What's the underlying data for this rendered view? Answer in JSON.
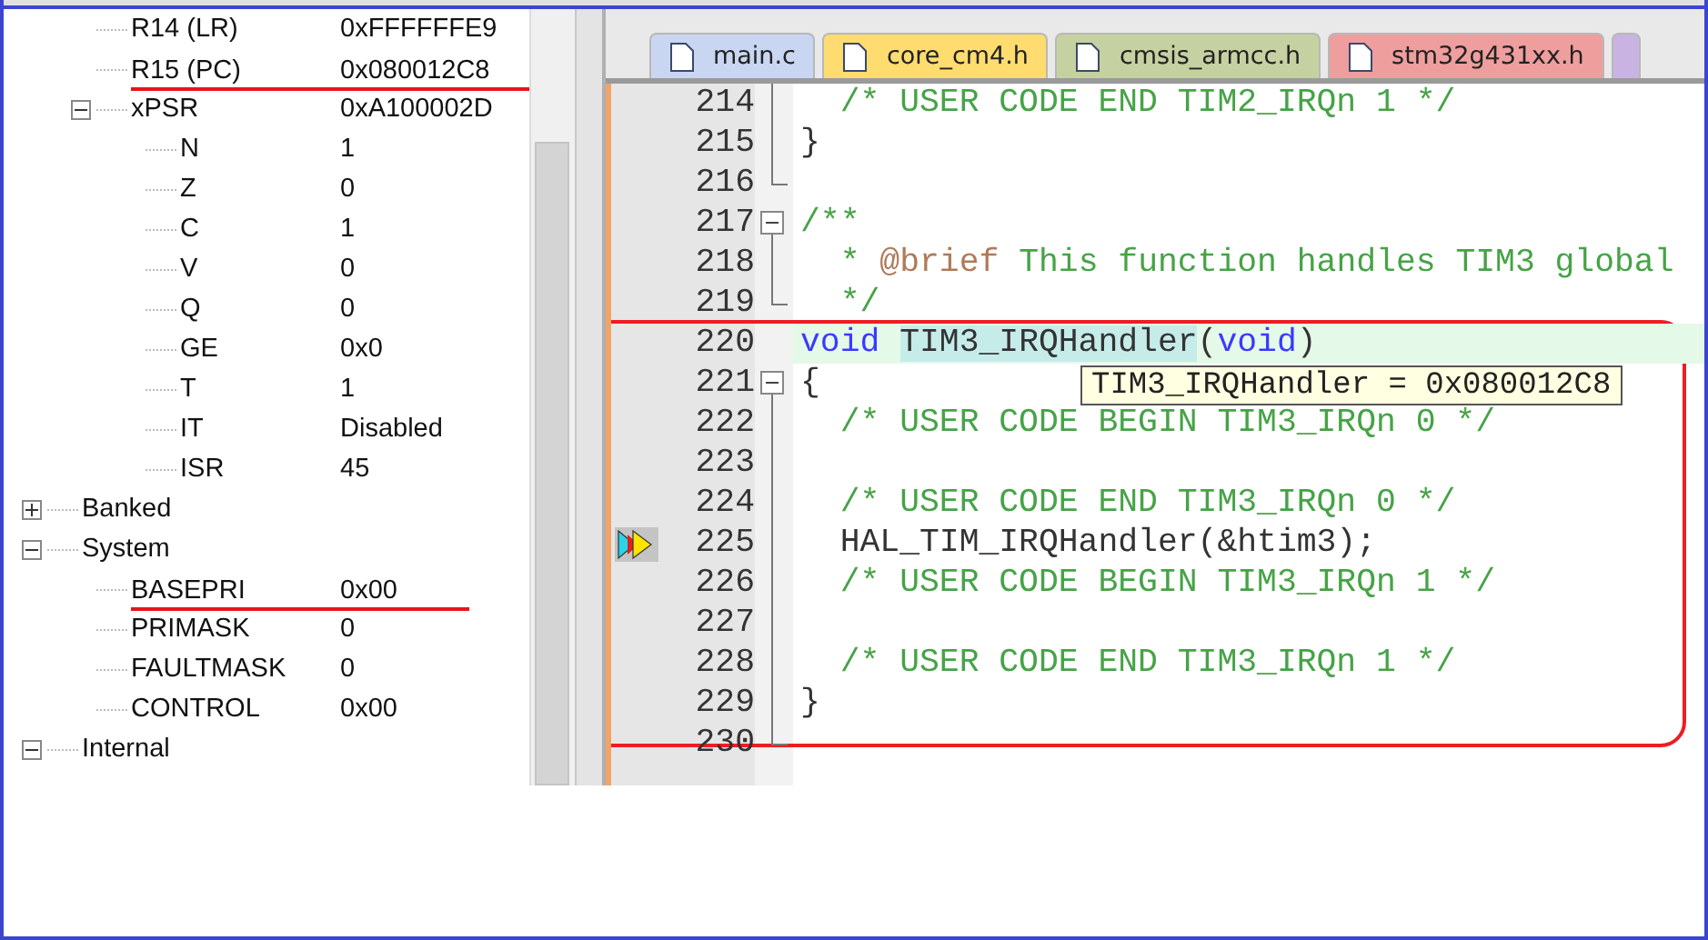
{
  "register_tree": [
    {
      "children": [
        {
          "name": "R14 (LR)",
          "value": "0xFFFFFFE9",
          "underlined": false
        },
        {
          "name": "R15 (PC)",
          "value": "0x080012C8",
          "underlined": true
        },
        {
          "name": "xPSR",
          "value": "0xA100002D",
          "underlined": false,
          "expanded": true,
          "children": [
            {
              "name": "N",
              "value": "1",
              "underlined": false
            },
            {
              "name": "Z",
              "value": "0",
              "underlined": false
            },
            {
              "name": "C",
              "value": "1",
              "underlined": false
            },
            {
              "name": "V",
              "value": "0",
              "underlined": false
            },
            {
              "name": "Q",
              "value": "0",
              "underlined": false
            },
            {
              "name": "GE",
              "value": "0x0",
              "underlined": false
            },
            {
              "name": "T",
              "value": "1",
              "underlined": false
            },
            {
              "name": "IT",
              "value": "Disabled",
              "underlined": false
            },
            {
              "name": "ISR",
              "value": "45",
              "underlined": false
            }
          ]
        }
      ]
    },
    {
      "name": "Banked",
      "expanded": false,
      "underlined": false
    },
    {
      "name": "System",
      "expanded": true,
      "underlined": false,
      "children": [
        {
          "name": "BASEPRI",
          "value": "0x00",
          "underlined": true
        },
        {
          "name": "PRIMASK",
          "value": "0",
          "underlined": false
        },
        {
          "name": "FAULTMASK",
          "value": "0",
          "underlined": false
        },
        {
          "name": "CONTROL",
          "value": "0x00",
          "underlined": false
        }
      ]
    },
    {
      "name": "Internal",
      "expanded": true,
      "underlined": false
    }
  ],
  "editor_tabs": [
    {
      "label": "main.c",
      "color": "#c9d6f2"
    },
    {
      "label": "core_cm4.h",
      "color": "#ffdc70"
    },
    {
      "label": "cmsis_armcc.h",
      "color": "#c6d1a2"
    },
    {
      "label": "stm32g431xx.h",
      "color": "#ef9e9e"
    },
    {
      "color": "#c9b3e3"
    }
  ],
  "code_lines": [
    {
      "number": "214",
      "kind": "line",
      "segments": [
        {
          "kind": "comment",
          "text": "  /* USER CODE END TIM2_IRQn 1 */"
        }
      ]
    },
    {
      "number": "215",
      "kind": "line",
      "segments": [
        {
          "kind": "plain",
          "text": "}"
        }
      ]
    },
    {
      "number": "216",
      "kind": "end"
    },
    {
      "number": "217",
      "kind": "start",
      "segments": [
        {
          "kind": "comment",
          "text": "/**"
        }
      ]
    },
    {
      "number": "218",
      "kind": "line",
      "segments": [
        {
          "kind": "comment",
          "text": "  * "
        },
        {
          "kind": "doctag",
          "text": "@brief"
        },
        {
          "kind": "comment",
          "text": " This function handles TIM3 global"
        }
      ]
    },
    {
      "number": "219",
      "kind": "end",
      "segments": [
        {
          "kind": "comment",
          "text": "  */"
        }
      ]
    }
  ],
  "annotated_code_lines": [
    {
      "number": "220",
      "kind": "none",
      "highlighted": true,
      "segments": [
        {
          "kind": "keyword",
          "text": "void "
        },
        {
          "kind": "match",
          "text": "TIM3_IRQHandler"
        },
        {
          "kind": "plain",
          "text": "("
        },
        {
          "kind": "keyword",
          "text": "void"
        },
        {
          "kind": "plain",
          "text": ")"
        }
      ]
    },
    {
      "number": "221",
      "kind": "start",
      "tooltip": "TIM3_IRQHandler = 0x080012C8",
      "segments": [
        {
          "kind": "plain",
          "text": "{"
        }
      ]
    },
    {
      "number": "222",
      "kind": "line",
      "segments": [
        {
          "kind": "comment",
          "text": "  /* USER CODE BEGIN TIM3_IRQn 0 */"
        }
      ]
    },
    {
      "number": "223",
      "kind": "line"
    },
    {
      "number": "224",
      "kind": "line",
      "segments": [
        {
          "kind": "comment",
          "text": "  /* USER CODE END TIM3_IRQn 0 */"
        }
      ]
    },
    {
      "number": "225",
      "kind": "line",
      "execution_marker": true,
      "segments": [
        {
          "kind": "plain",
          "text": "  HAL_TIM_IRQHandler(&htim3);"
        }
      ]
    },
    {
      "number": "226",
      "kind": "line",
      "segments": [
        {
          "kind": "comment",
          "text": "  /* USER CODE BEGIN TIM3_IRQn 1 */"
        }
      ]
    },
    {
      "number": "227",
      "kind": "line"
    },
    {
      "number": "228",
      "kind": "line",
      "segments": [
        {
          "kind": "comment",
          "text": "  /* USER CODE END TIM3_IRQn 1 */"
        }
      ]
    },
    {
      "number": "229",
      "kind": "line",
      "segments": [
        {
          "kind": "plain",
          "text": "}"
        }
      ]
    }
  ],
  "code_lines_after": [
    {
      "number": "230",
      "kind": "end"
    }
  ]
}
